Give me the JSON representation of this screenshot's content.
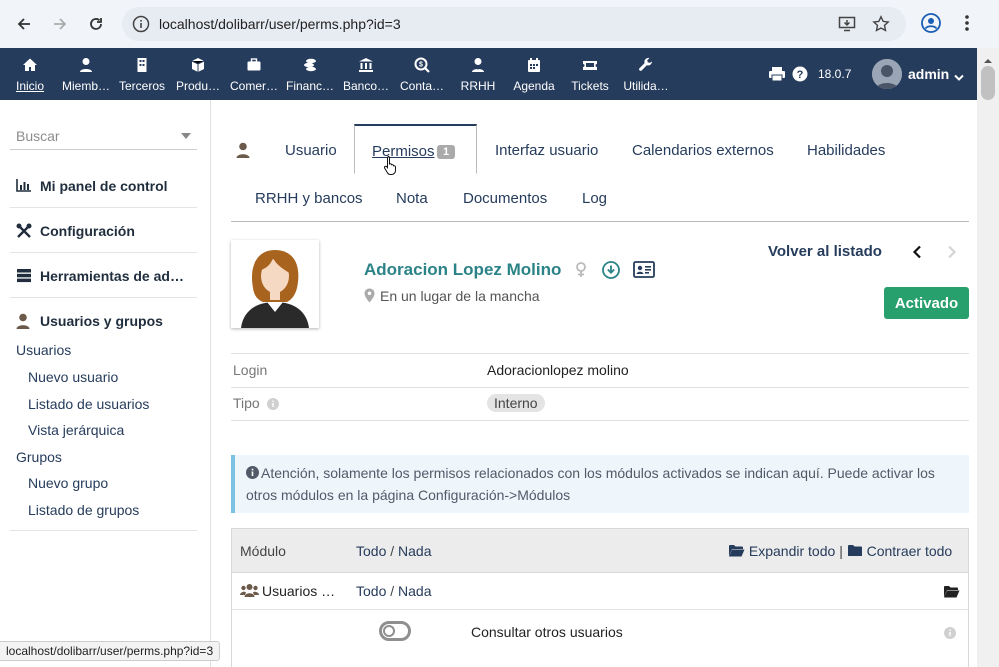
{
  "browser": {
    "url": "localhost/dolibarr/user/perms.php?id=3",
    "status_url": "localhost/dolibarr/user/perms.php?id=3"
  },
  "topbar": {
    "items": [
      {
        "label": "Inicio",
        "icon": "home-icon"
      },
      {
        "label": "Miemb…",
        "icon": "member-icon"
      },
      {
        "label": "Terceros",
        "icon": "building-icon"
      },
      {
        "label": "Produ…",
        "icon": "cube-icon"
      },
      {
        "label": "Comer…",
        "icon": "briefcase-icon"
      },
      {
        "label": "Financ…",
        "icon": "coins-icon"
      },
      {
        "label": "Banco…",
        "icon": "bank-icon"
      },
      {
        "label": "Conta…",
        "icon": "search-dollar-icon"
      },
      {
        "label": "RRHH",
        "icon": "user-tie-icon"
      },
      {
        "label": "Agenda",
        "icon": "calendar-icon"
      },
      {
        "label": "Tickets",
        "icon": "ticket-icon"
      },
      {
        "label": "Utilida…",
        "icon": "wrench-icon"
      }
    ],
    "version": "18.0.7",
    "user": "admin"
  },
  "sidebar": {
    "search_placeholder": "Buscar",
    "sections": [
      {
        "label": "Mi panel de control",
        "icon": "chart-icon"
      },
      {
        "label": "Configuración",
        "icon": "tools-icon"
      },
      {
        "label": "Herramientas de ad…",
        "icon": "server-icon"
      },
      {
        "label": "Usuarios y grupos",
        "icon": "user-icon"
      }
    ],
    "links": {
      "usuarios": "Usuarios",
      "nuevo_usuario": "Nuevo usuario",
      "listado_usuarios": "Listado de usuarios",
      "vista_jerarquica": "Vista jerárquica",
      "grupos": "Grupos",
      "nuevo_grupo": "Nuevo grupo",
      "listado_grupos": "Listado de grupos"
    }
  },
  "tabs": {
    "usuario": "Usuario",
    "permisos": "Permisos",
    "permisos_count": "1",
    "interfaz": "Interfaz usuario",
    "calendarios": "Calendarios externos",
    "habilidades": "Habilidades",
    "rrhh": "RRHH y bancos",
    "nota": "Nota",
    "documentos": "Documentos",
    "log": "Log"
  },
  "profile": {
    "name": "Adoracion Lopez Molino",
    "location": "En un lugar de la mancha",
    "back": "Volver al listado",
    "status": "Activado",
    "status_color": "#28a06e"
  },
  "fields": {
    "login_label": "Login",
    "login_value": "Adoracionlopez molino",
    "tipo_label": "Tipo",
    "tipo_value": "Interno"
  },
  "notice": "Atención, solamente los permisos relacionados con los módulos activados se indican aquí. Puede activar los otros módulos en la página Configuración->Módulos",
  "permissions": {
    "header_module": "Módulo",
    "todo": "Todo",
    "sep": "/",
    "nada": "Nada",
    "expand": "Expandir todo",
    "bar": "|",
    "collapse": "Contraer todo",
    "rows": [
      {
        "module": "Usuarios …",
        "todo": "Todo",
        "nada": "Nada"
      },
      {
        "permission": "Consultar otros usuarios"
      }
    ]
  },
  "colors": {
    "topbar": "#263c5c",
    "accent_name": "#2b8287"
  }
}
